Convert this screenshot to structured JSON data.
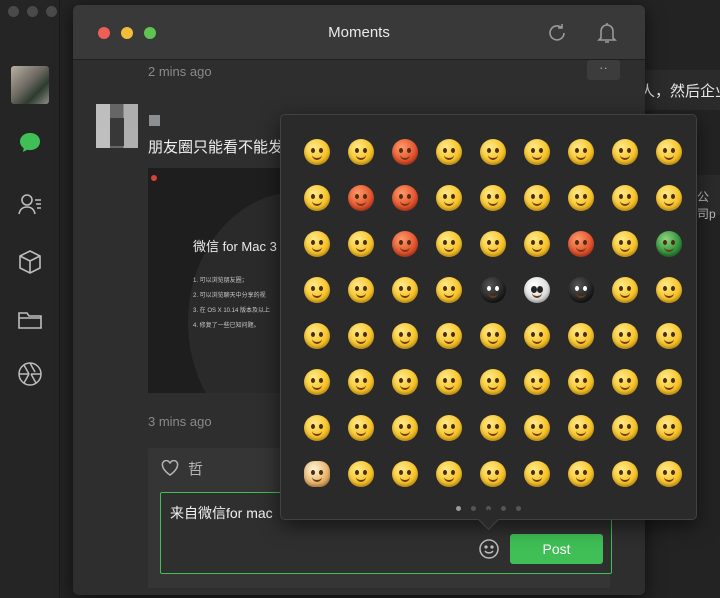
{
  "window": {
    "title": "Moments"
  },
  "background_chat": {
    "line1": "人，然后企业",
    "line2": "公司p"
  },
  "feed": {
    "post": {
      "time": "2 mins ago",
      "text": "朋友圈只能看不能发",
      "card_title": "微信 for Mac 3",
      "card_items": [
        "1. 可以浏览朋友圈；",
        "2. 可以浏览聊天中分享的视",
        "3. 在 OS X 10.14 版本及以上",
        "4. 修复了一些已知问题。"
      ]
    },
    "post2_time": "3 mins ago",
    "comment": {
      "likes_label": "哲",
      "input_value": "来自微信for mac",
      "post_label": "Post"
    }
  },
  "emoji_picker": {
    "rows": 8,
    "cols": 9,
    "pages": 5,
    "active_page": 0
  },
  "colors": {
    "accent": "#3fbf55",
    "window_bg": "#2e2e2e",
    "titlebar": "#3a3939"
  }
}
